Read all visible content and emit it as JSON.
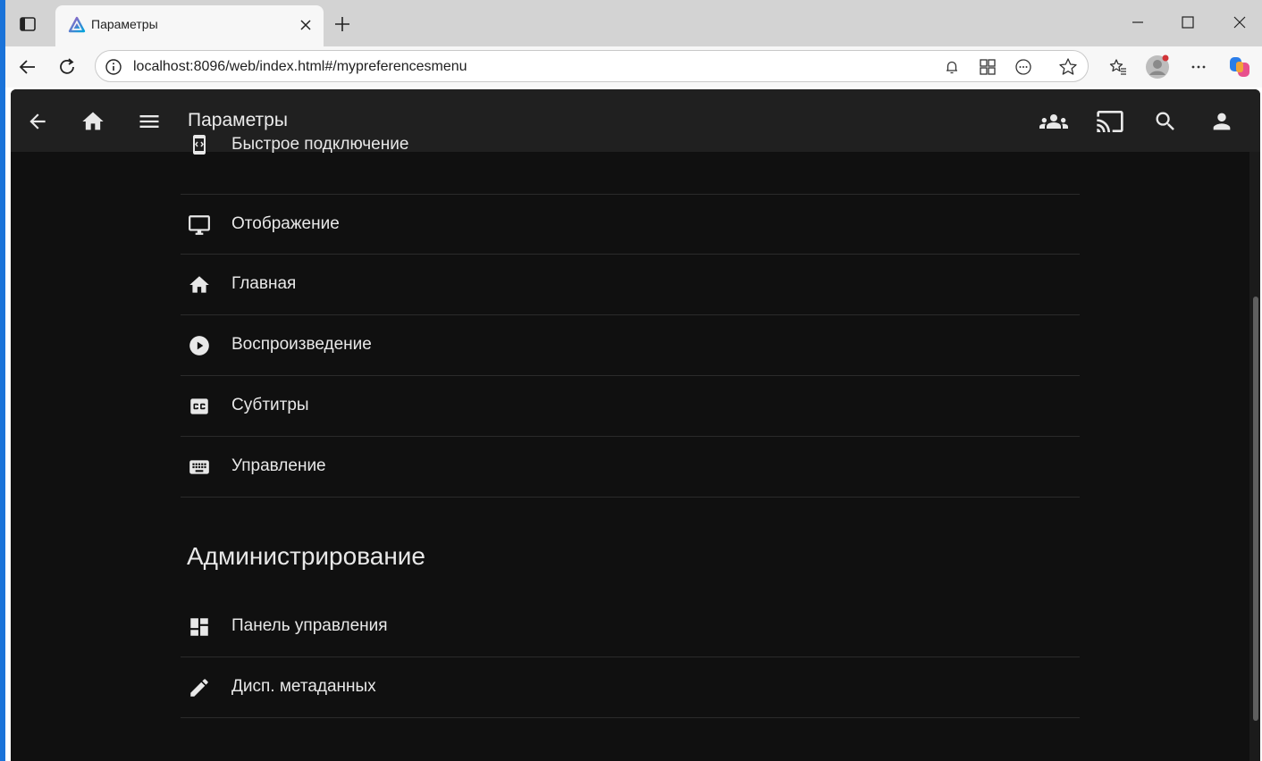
{
  "browser": {
    "tab_title": "Параметры",
    "url": "localhost:8096/web/index.html#/mypreferencesmenu",
    "icons": [
      "tab-actions-icon",
      "new-tab-icon",
      "minimize-icon",
      "maximize-icon",
      "close-window-icon",
      "back-icon",
      "refresh-icon",
      "info-icon",
      "notification-bell-icon",
      "extensions-icon",
      "page-options-icon",
      "favorite-star-icon",
      "favorites-icon",
      "profile-avatar-icon",
      "more-icon",
      "copilot-icon"
    ]
  },
  "header": {
    "title": "Параметры",
    "icons": [
      "back-arrow-icon",
      "home-icon",
      "menu-icon",
      "syncplay-group-icon",
      "cast-icon",
      "search-icon",
      "user-icon"
    ]
  },
  "menu": {
    "items": [
      {
        "label": "Быстрое подключение",
        "icon": "quick-connect-icon"
      },
      {
        "label": "Отображение",
        "icon": "display-icon"
      },
      {
        "label": "Главная",
        "icon": "home-icon"
      },
      {
        "label": "Воспроизведение",
        "icon": "play-circle-icon"
      },
      {
        "label": "Субтитры",
        "icon": "closed-caption-icon"
      },
      {
        "label": "Управление",
        "icon": "keyboard-icon"
      }
    ]
  },
  "admin": {
    "title": "Администрирование",
    "items": [
      {
        "label": "Панель управления",
        "icon": "dashboard-icon"
      },
      {
        "label": "Дисп. метаданных",
        "icon": "edit-pencil-icon"
      }
    ]
  },
  "colors": {
    "page_bg": "#101010",
    "header_bg": "#202020",
    "text": "#e8e8e8",
    "divider": "#2b2b2b"
  }
}
